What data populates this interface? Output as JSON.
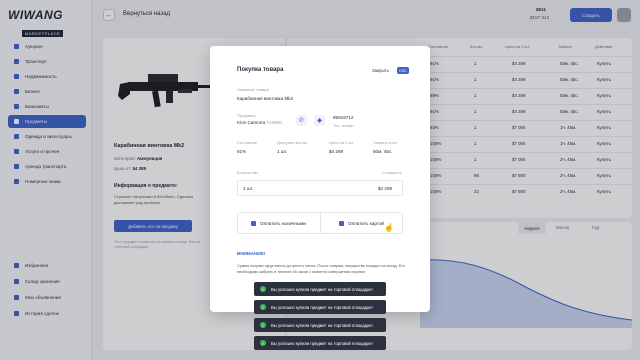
{
  "logo": {
    "main": "WIWANG",
    "sub": "MARKETPLACE"
  },
  "header": {
    "back_label": "Вернуться назад",
    "balance1": "$511",
    "balance2": "$157 312",
    "create_label": "Создать"
  },
  "sidebar": {
    "top": [
      "Аукцион",
      "Транспорт",
      "Недвижимость",
      "Бизнес",
      "Банкоматы",
      "Предметы",
      "Одежда и аксессуары",
      "Услуги и прочее",
      "Аренда транспорта",
      "Номерные знаки"
    ],
    "bottom": [
      "Избранное",
      "Склад хранения",
      "Мои объявления",
      "История сделок"
    ]
  },
  "product": {
    "title": "Карабинная винтовка Mk2",
    "category_label": "Категория:",
    "category_value": "Аммуниция",
    "price_label": "Цена от:",
    "price_value": "$4 289",
    "info_title": "Информация о предмете:",
    "info_text": "Стреляет патронами 5.56x45mm. Сделано доставляет ряд проблем",
    "tg_button": "Добавить лот на продажу",
    "note": "Этот предмет появился на вашем складе. Вы на торговой площадке"
  },
  "table": {
    "headers": [
      "Состояние",
      "Кол-во",
      "Цена за 1 шт.",
      "Таймер",
      "Действие"
    ],
    "rows": [
      [
        "91%",
        "1",
        "$4 289",
        "50м. 45с.",
        "Купить"
      ],
      [
        "91%",
        "1",
        "$4 289",
        "50м. 45с.",
        "Купить"
      ],
      [
        "89%",
        "1",
        "$4 289",
        "50м. 45с.",
        "Купить"
      ],
      [
        "91%",
        "1",
        "$4 289",
        "50м. 45с.",
        "Купить"
      ],
      [
        "93%",
        "1",
        "$7 000",
        "1ч. 45м.",
        "Купить"
      ],
      [
        "100%",
        "1",
        "$7 000",
        "1ч. 45м.",
        "Купить"
      ],
      [
        "100%",
        "1",
        "$7 000",
        "2ч. 45м.",
        "Купить"
      ],
      [
        "100%",
        "96",
        "$7 500",
        "2ч. 45м.",
        "Купить"
      ],
      [
        "100%",
        "22",
        "$7 500",
        "2ч. 45м.",
        "Купить"
      ]
    ]
  },
  "chart_tabs": [
    "Неделя",
    "Месяц",
    "Год"
  ],
  "modal": {
    "title": "Покупка товара",
    "close_label": "Закрыть",
    "esc_label": "ESC",
    "name_label": "Название товара",
    "name_value": "Карабинная винтовка Mk2",
    "seller_label": "Продавец",
    "seller_value": "Kion Camorra",
    "seller_id": "#10860",
    "phone_value": "85916712",
    "phone_label": "Тел. номер",
    "condition_label": "Состояние",
    "condition_value": "91%",
    "available_label": "Доступно кол-во",
    "available_value": "1 шт.",
    "price_label": "Цена за 1 шт.",
    "price_value": "$4 289",
    "timer_label": "Таймер лота",
    "timer_value": "50м. 45с.",
    "qty_label": "Количество",
    "total_label": "Стоимость",
    "qty_value": "1 шт.",
    "total_value": "$4 289",
    "pay_cash": "Оплатить наличными",
    "pay_card": "Оплатить картой",
    "warn_title": "ВНИМАНИЕ!",
    "warn_text": "Сумма покупки округляется до целого числа. После покупки, имущество попадет на склад. Его необходимо забрать в течение 48 часов с момента совершения покупки"
  },
  "toasts": [
    "Вы успешно купили предмет на торговой площадке!",
    "Вы успешно купили предмет на торговой площадке!",
    "Вы успешно купили предмет на торговой площадке!",
    "Вы успешно купили предмет на торговой площадке!"
  ],
  "colors": {
    "accent": "#3d63c9",
    "toast_bg": "#2c3140",
    "success": "#3fb950"
  }
}
